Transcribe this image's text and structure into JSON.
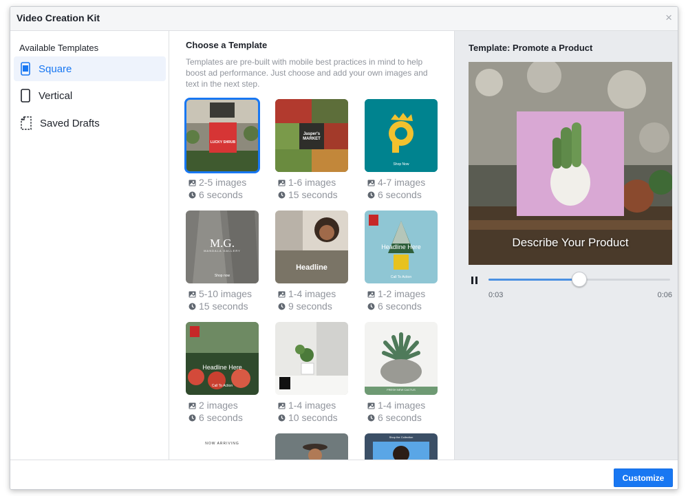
{
  "window": {
    "title": "Video Creation Kit",
    "close_glyph": "×"
  },
  "sidebar": {
    "heading": "Available Templates",
    "items": [
      {
        "label": "Square",
        "icon": "square-phone-icon",
        "active": true
      },
      {
        "label": "Vertical",
        "icon": "vertical-phone-icon",
        "active": false
      },
      {
        "label": "Saved Drafts",
        "icon": "draft-document-icon",
        "active": false
      }
    ]
  },
  "main": {
    "title": "Choose a Template",
    "description": "Templates are pre-built with mobile best practices in mind to help boost ad performance. Just choose and add your own images and text in the next step.",
    "templates": [
      {
        "images": "2-5 images",
        "duration": "6 seconds",
        "thumb_text": "LUCKY SHRUB",
        "selected": true
      },
      {
        "images": "1-6 images",
        "duration": "15 seconds",
        "thumb_text": "Jasper's MARKET"
      },
      {
        "images": "4-7 images",
        "duration": "6 seconds",
        "thumb_text": "Shop Now"
      },
      {
        "images": "5-10 images",
        "duration": "15 seconds",
        "thumb_text": "M.G.",
        "thumb_sub": "MANDALA GALLERY",
        "thumb_cta": "Shop now"
      },
      {
        "images": "1-4 images",
        "duration": "9 seconds",
        "thumb_text": "Headline"
      },
      {
        "images": "1-2 images",
        "duration": "6 seconds",
        "thumb_text": "Headline Here",
        "thumb_cta": "Call To Action"
      },
      {
        "images": "2 images",
        "duration": "6 seconds",
        "thumb_text": "Headline Here",
        "thumb_cta": "Call To Action"
      },
      {
        "images": "1-4 images",
        "duration": "10 seconds",
        "thumb_text": ""
      },
      {
        "images": "1-4 images",
        "duration": "6 seconds",
        "thumb_text": "FRESH NEW CACTUS"
      },
      {
        "thumb_text": "NOW ARRIVING"
      },
      {
        "thumb_text": ""
      },
      {
        "thumb_text": "Shop the Collection"
      }
    ]
  },
  "preview": {
    "title": "Template: Promote a Product",
    "caption": "Describe Your Product",
    "current_time": "0:03",
    "total_time": "0:06",
    "progress": 0.5
  },
  "footer": {
    "customize_label": "Customize"
  },
  "colors": {
    "accent": "#1877f2",
    "teal": "#00838f",
    "pink": "#d9a8d4"
  }
}
